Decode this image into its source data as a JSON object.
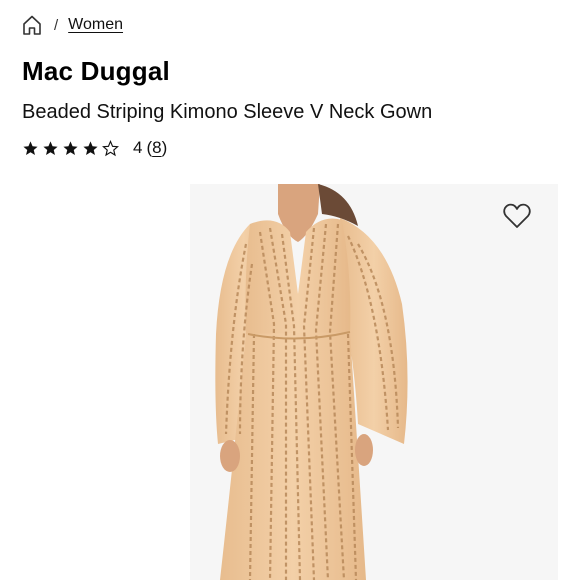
{
  "breadcrumb": {
    "home_icon": "home-icon",
    "separator": "/",
    "current": "Women"
  },
  "product": {
    "brand": "Mac Duggal",
    "name": "Beaded Striping Kimono Sleeve V Neck Gown",
    "rating": {
      "stars_filled": 4,
      "stars_total": 5,
      "value_text": "4",
      "review_count_open": "(",
      "review_count": "8",
      "review_count_close": ")"
    },
    "image": {
      "description_icon": "gown-photo",
      "dress_color": "#f0c9a0",
      "sequin_color": "#c99a66",
      "skin_color": "#d9a47e"
    },
    "wishlist_icon": "heart-icon"
  }
}
